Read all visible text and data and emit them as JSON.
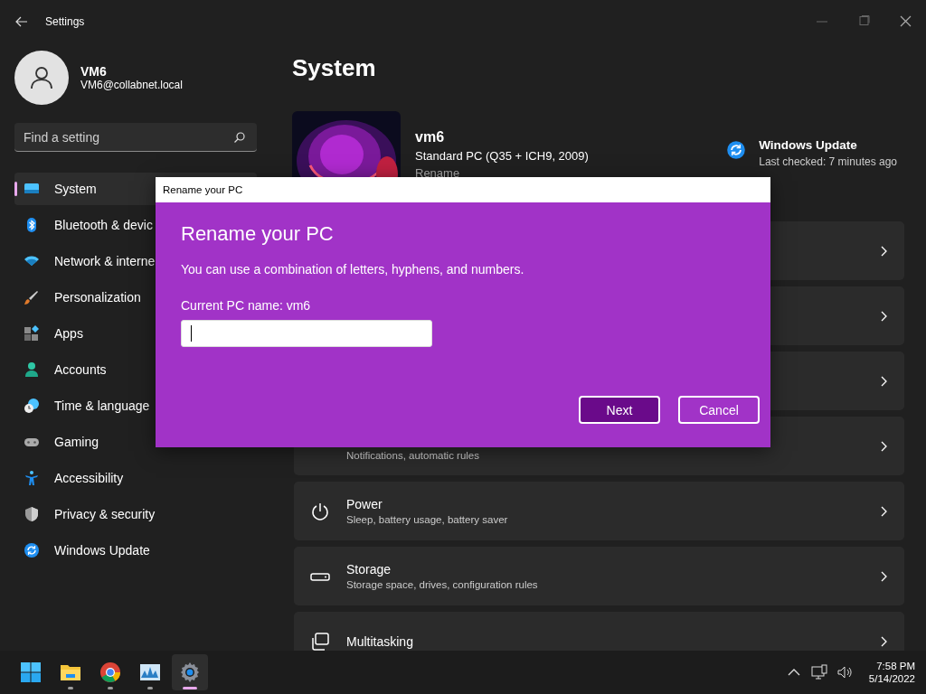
{
  "window": {
    "title": "Settings"
  },
  "user": {
    "name": "VM6",
    "email": "VM6@collabnet.local"
  },
  "search": {
    "placeholder": "Find a setting"
  },
  "sidebar": {
    "items": [
      {
        "label": "System",
        "kind": "system",
        "selected": true
      },
      {
        "label": "Bluetooth & devic",
        "kind": "bluetooth",
        "selected": false
      },
      {
        "label": "Network & interne",
        "kind": "network",
        "selected": false
      },
      {
        "label": "Personalization",
        "kind": "brush",
        "selected": false
      },
      {
        "label": "Apps",
        "kind": "apps",
        "selected": false
      },
      {
        "label": "Accounts",
        "kind": "accounts",
        "selected": false
      },
      {
        "label": "Time & language",
        "kind": "time",
        "selected": false
      },
      {
        "label": "Gaming",
        "kind": "gaming",
        "selected": false
      },
      {
        "label": "Accessibility",
        "kind": "accessibility",
        "selected": false
      },
      {
        "label": "Privacy & security",
        "kind": "privacy",
        "selected": false
      },
      {
        "label": "Windows Update",
        "kind": "update",
        "selected": false
      }
    ]
  },
  "page": {
    "title": "System"
  },
  "device": {
    "name": "vm6",
    "model": "Standard PC (Q35 + ICH9, 2009)",
    "rename_link": "Rename"
  },
  "update_status": {
    "title": "Windows Update",
    "subtitle": "Last checked: 7 minutes ago"
  },
  "cards": [
    {
      "kind": "covered"
    },
    {
      "kind": "covered"
    },
    {
      "kind": "covered"
    },
    {
      "kind": "partial",
      "subtitle": "Notifications, automatic rules"
    },
    {
      "kind": "power",
      "title": "Power",
      "subtitle": "Sleep, battery usage, battery saver"
    },
    {
      "kind": "storage",
      "title": "Storage",
      "subtitle": "Storage space, drives, configuration rules"
    },
    {
      "kind": "multitasking",
      "title": "Multitasking"
    }
  ],
  "dialog": {
    "title": "Rename your PC",
    "heading": "Rename your PC",
    "description": "You can use a combination of letters, hyphens, and numbers.",
    "current_name_label": "Current PC name: vm6",
    "buttons": [
      {
        "label": "Next",
        "kind": "primary"
      },
      {
        "label": "Cancel",
        "kind": "secondary"
      }
    ]
  },
  "taskbar": {
    "apps": [
      {
        "kind": "start",
        "running": false,
        "selected": false
      },
      {
        "kind": "folder",
        "running": true,
        "selected": false
      },
      {
        "kind": "browser",
        "running": true,
        "selected": false
      },
      {
        "kind": "monitor",
        "running": true,
        "selected": false
      },
      {
        "kind": "settings",
        "running": true,
        "selected": true
      }
    ],
    "clock": {
      "time": "7:58 PM",
      "date": "5/14/2022"
    }
  }
}
